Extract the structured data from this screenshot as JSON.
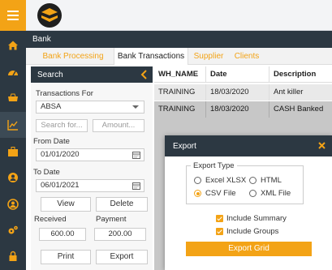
{
  "app": {
    "section_title": "Bank"
  },
  "icons": {
    "nav": [
      "home-icon",
      "dashboard-icon",
      "cart-icon",
      "chart-icon",
      "briefcase-icon",
      "user-circle-icon",
      "account-icon",
      "cogs-icon",
      "lock-icon"
    ]
  },
  "colors": {
    "accent": "#f3a316",
    "dark": "#2c3842"
  },
  "tabs": [
    {
      "label": "Bank Processing",
      "state": "inactive"
    },
    {
      "label": "Bank Transactions",
      "state": "active"
    },
    {
      "label": "Supplier",
      "state": "inactive"
    },
    {
      "label": "Clients",
      "state": "inactive"
    }
  ],
  "search": {
    "title": "Search",
    "transactions_for_label": "Transactions For",
    "transactions_for_value": "ABSA",
    "search_for_placeholder": "Search for...",
    "amount_placeholder": "Amount...",
    "from_date_label": "From Date",
    "from_date_value": "01/01/2020",
    "to_date_label": "To Date",
    "to_date_value": "06/01/2021",
    "view_button": "View",
    "delete_button": "Delete",
    "received_label": "Received",
    "payment_label": "Payment",
    "received_value": "600.00",
    "payment_value": "200.00",
    "print_button": "Print",
    "export_button": "Export"
  },
  "grid": {
    "columns": [
      "WH_NAME",
      "Date",
      "Description"
    ],
    "rows": [
      [
        "TRAINING",
        "18/03/2020",
        "Ant killer"
      ],
      [
        "TRAINING",
        "18/03/2020",
        "CASH Banked"
      ]
    ]
  },
  "export_dialog": {
    "title": "Export",
    "export_type_legend": "Export Type",
    "options": [
      {
        "label": "Excel XLSX",
        "selected": false
      },
      {
        "label": "HTML",
        "selected": false
      },
      {
        "label": "CSV File",
        "selected": true
      },
      {
        "label": "XML File",
        "selected": false
      }
    ],
    "include_summary_label": "Include Summary",
    "include_summary_checked": true,
    "include_groups_label": "Include Groups",
    "include_groups_checked": true,
    "export_grid_button": "Export Grid"
  }
}
